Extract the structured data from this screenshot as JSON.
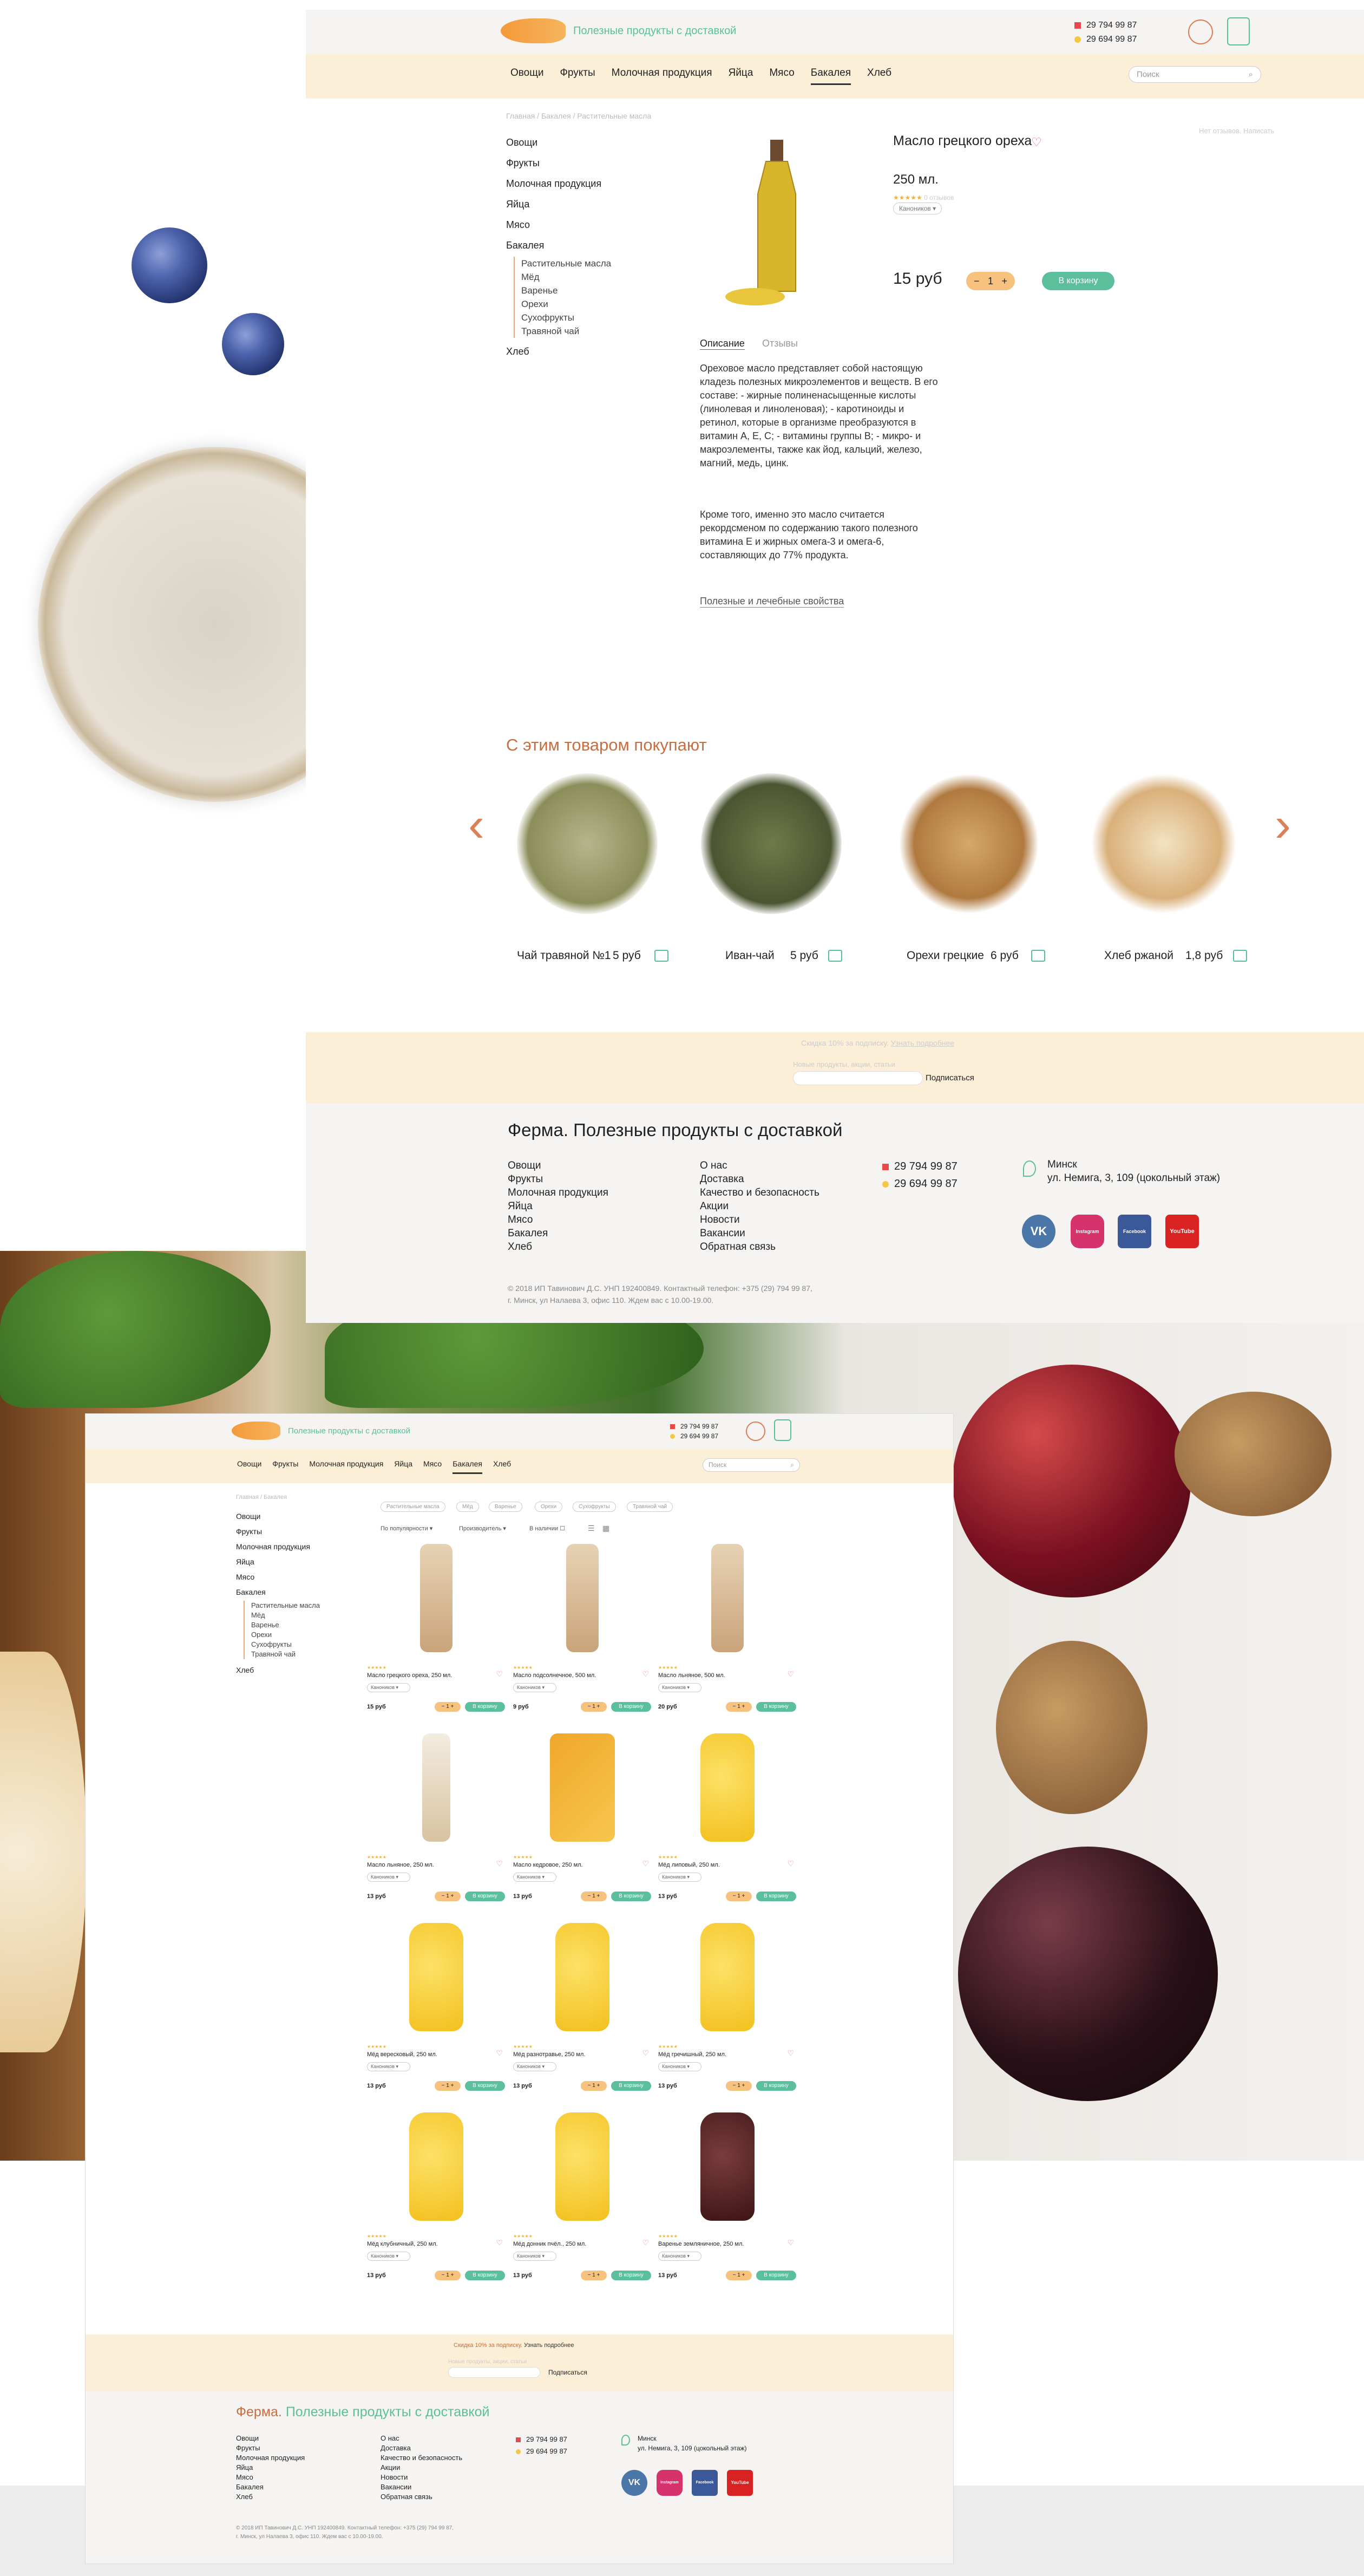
{
  "colors": {
    "accent_green": "#5bbf9c",
    "accent_orange": "#c96d3e",
    "nav_bg": "#fcefd8",
    "qty_bg": "#f6c27e",
    "heart": "#e06c8b"
  },
  "product_page": {
    "tagline": "Полезные продукты с доставкой",
    "phones": [
      "29 794 99 87",
      "29 694 99 87"
    ],
    "nav": [
      "Овощи",
      "Фрукты",
      "Молочная продукция",
      "Яйца",
      "Мясо",
      "Бакалея",
      "Хлеб"
    ],
    "nav_active": "Бакалея",
    "search_placeholder": "Поиск",
    "breadcrumb": "Главная / Бакалея / Растительные масла",
    "categories": [
      "Овощи",
      "Фрукты",
      "Молочная продукция",
      "Яйца",
      "Мясо",
      "Бакалея"
    ],
    "subcategories": [
      "Растительные масла",
      "Мёд",
      "Варенье",
      "Орехи",
      "Сухофрукты",
      "Травяной чай"
    ],
    "last_category": "Хлеб",
    "product": {
      "title": "Масло грецкого ореха",
      "volume": "250 мл.",
      "reviews": "0 отзывов",
      "rating": 0,
      "select": "Каноников",
      "price": "15 руб",
      "qty": "1",
      "add_to_cart": "В корзину",
      "top_right_link": "Нет отзывов. Написать"
    },
    "tabs": [
      "Описание",
      "Отзывы"
    ],
    "description_1": "Ореховое масло представляет собой настоящую кладезь полезных микроэлементов и веществ. В его составе: - жирные полиненасыщенные кислоты (линолевая и линоленовая); - каротиноиды и ретинол, которые в организме преобразуются в витамин А, Е, С; - витамины группы В; - микро- и макроэлементы, также как йод, кальций, железо, магний, медь, цинк.",
    "description_2": "Кроме того, именно это масло считается рекордсменом по содержанию такого полезного витамина Е и жирных омега-3 и омега-6, составляющих до 77% продукта.",
    "more_link": "Полезные и лечебные свойства",
    "recs_title": "С этим товаром покупают",
    "recs": [
      {
        "name": "Чай травяной №1",
        "price": "5 руб",
        "icon": "herbal-tea"
      },
      {
        "name": "Иван-чай",
        "price": "5 руб",
        "icon": "ivan-tea"
      },
      {
        "name": "Орехи грецкие",
        "price": "6 руб",
        "icon": "walnuts"
      },
      {
        "name": "Хлеб ржаной",
        "price": "1,8 руб",
        "icon": "bread"
      }
    ],
    "subscribe": {
      "discount": "Скидка 10% за подписку.",
      "discount_link": "Узнать подробнее",
      "label": "Новые продукты, акции, статьи",
      "button": "Подписаться"
    },
    "footer": {
      "title": "Ферма. Полезные продукты с доставкой",
      "col1": [
        "Овощи",
        "Фрукты",
        "Молочная продукция",
        "Яйца",
        "Мясо",
        "Бакалея",
        "Хлеб"
      ],
      "col2": [
        "О нас",
        "Доставка",
        "Качество и безопасность",
        "Акции",
        "Новости",
        "Вакансии",
        "Обратная связь"
      ],
      "phones": [
        "29 794 99 87",
        "29 694 99 87"
      ],
      "city": "Минск",
      "address": "ул. Немига, 3, 109 (цокольный этаж)",
      "socials": [
        "VK",
        "Instagram",
        "Facebook",
        "YouTube"
      ],
      "legal1": "© 2018 ИП Тавинович Д.С. УНП 192400849. Контактный телефон: +375 (29) 794 99 87,",
      "legal2": "г. Минск, ул Налаева 3, офис 110. Ждем вас с 10.00-19.00."
    }
  },
  "catalog_page": {
    "tagline": "Полезные продукты с доставкой",
    "phones": [
      "29 794 99 87",
      "29 694 99 87"
    ],
    "nav": [
      "Овощи",
      "Фрукты",
      "Молочная продукция",
      "Яйца",
      "Мясо",
      "Бакалея",
      "Хлеб"
    ],
    "search_placeholder": "Поиск",
    "breadcrumb": "Главная / Бакалея",
    "categories": [
      "Овощи",
      "Фрукты",
      "Молочная продукция",
      "Яйца",
      "Мясо",
      "Бакалея"
    ],
    "subcategories": [
      "Растительные масла",
      "Мёд",
      "Варенье",
      "Орехи",
      "Сухофрукты",
      "Травяной чай"
    ],
    "last_category": "Хлеб",
    "filters": [
      "Растительные масла",
      "Мёд",
      "Варенье",
      "Орехи",
      "Сухофрукты",
      "Травяной чай"
    ],
    "sort": [
      "По популярности",
      "Производитель",
      "В наличии"
    ],
    "products": [
      {
        "name": "Масло грецкого ореха, 250 мл.",
        "price": "15 руб",
        "img": "bottle"
      },
      {
        "name": "Масло подсолнечное, 500 мл.",
        "price": "9 руб",
        "img": "bottle"
      },
      {
        "name": "Масло льняное, 500 мл.",
        "price": "20 руб",
        "img": "bottle"
      },
      {
        "name": "Масло льняное, 250 мл.",
        "price": "13 руб",
        "img": "bottle-clear"
      },
      {
        "name": "Масло кедровое, 250 мл.",
        "price": "13 руб",
        "img": "box"
      },
      {
        "name": "Мёд липовый, 250 мл.",
        "price": "13 руб",
        "img": "honey"
      },
      {
        "name": "Мёд вересковый, 250 мл.",
        "price": "13 руб",
        "img": "honey"
      },
      {
        "name": "Мёд разнотравье, 250 мл.",
        "price": "13 руб",
        "img": "honey"
      },
      {
        "name": "Мёд гречишный, 250 мл.",
        "price": "13 руб",
        "img": "honey"
      },
      {
        "name": "Мёд клубничный, 250 мл.",
        "price": "13 руб",
        "img": "honey"
      },
      {
        "name": "Мёд донник пчёл., 250 мл.",
        "price": "13 руб",
        "img": "honey"
      },
      {
        "name": "Варенье земляничное, 250 мл.",
        "price": "13 руб",
        "img": "jam"
      }
    ],
    "product_select": "Каноников",
    "qty": "1",
    "add_to_cart": "В корзину",
    "subscribe": {
      "discount": "Скидка 10% за подписку.",
      "discount_link": "Узнать подробнее",
      "label": "Новые продукты, акции, статьи",
      "button": "Подписаться"
    },
    "footer": {
      "title_a": "Ферма.",
      "title_b": "Полезные продукты с доставкой",
      "col1": [
        "Овощи",
        "Фрукты",
        "Молочная продукция",
        "Яйца",
        "Мясо",
        "Бакалея",
        "Хлеб"
      ],
      "col2": [
        "О нас",
        "Доставка",
        "Качество и безопасность",
        "Акции",
        "Новости",
        "Вакансии",
        "Обратная связь"
      ],
      "phones": [
        "29 794 99 87",
        "29 694 99 87"
      ],
      "city": "Минск",
      "address": "ул. Немига, 3, 109 (цокольный этаж)",
      "socials": [
        "VK",
        "Instagram",
        "Facebook",
        "YouTube"
      ],
      "legal1": "© 2018 ИП Тавинович Д.С. УНП 192400849. Контактный телефон: +375 (29) 794 99 87,",
      "legal2": "г. Минск, ул Налаева 3, офис 110. Ждем вас с 10.00-19.00."
    }
  }
}
